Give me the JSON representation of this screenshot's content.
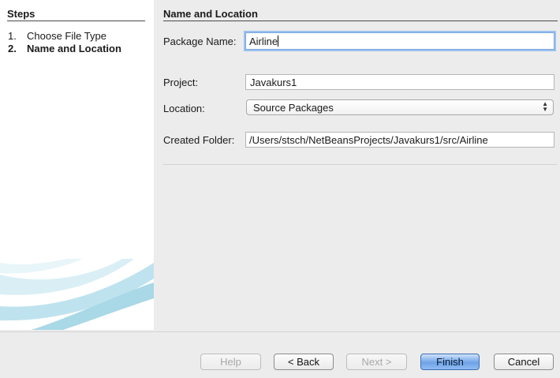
{
  "sidebar": {
    "heading": "Steps",
    "steps": [
      {
        "num": "1.",
        "label": "Choose File Type"
      },
      {
        "num": "2.",
        "label": "Name and Location"
      }
    ]
  },
  "panel": {
    "heading": "Name and Location",
    "package_name": {
      "label": "Package Name:",
      "value": "Airline"
    },
    "project": {
      "label": "Project:",
      "value": "Javakurs1"
    },
    "location": {
      "label": "Location:",
      "value": "Source Packages"
    },
    "created_folder": {
      "label": "Created Folder:",
      "value": "/Users/stsch/NetBeansProjects/Javakurs1/src/Airline"
    }
  },
  "buttons": {
    "help": "Help",
    "back": "< Back",
    "next": "Next >",
    "finish": "Finish",
    "cancel": "Cancel"
  },
  "colors": {
    "default_button": "#6ea3e8",
    "focus_ring": "#9cc2ee",
    "swoosh": "#bfe3ee"
  }
}
